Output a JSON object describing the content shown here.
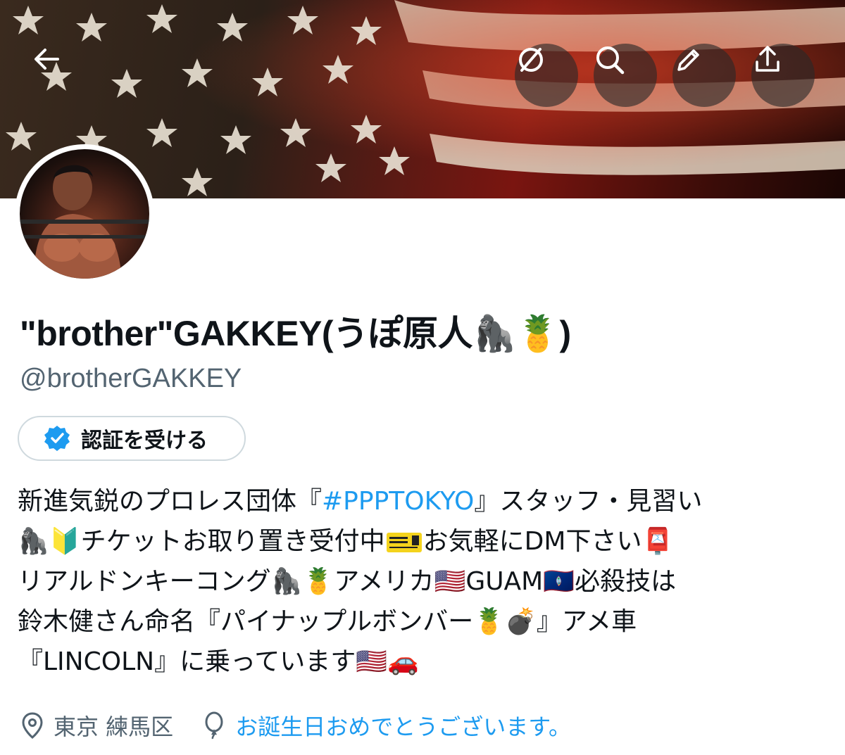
{
  "header": {
    "back_icon": "arrow-left-icon",
    "actions": [
      {
        "icon": "circle-slash-icon"
      },
      {
        "icon": "search-icon"
      },
      {
        "icon": "pencil-icon"
      },
      {
        "icon": "share-icon"
      }
    ]
  },
  "profile": {
    "display_name": "\"brother\"GAKKEY(うぽ原人🦍🍍)",
    "handle": "@brotherGAKKEY",
    "verify_button": "認証を受ける"
  },
  "bio": {
    "l1a": "新進気鋭のプロレス団体『",
    "l1link": "#PPPTOKYO",
    "l1b": "』スタッフ・見習い",
    "l2a": "🦍🔰チケットお取り置き受付中",
    "l2b": "お気軽にDM下さい📮",
    "l3": "リアルドンキーコング🦍🍍アメリカ🇺🇸GUAM🇬🇺必殺技は",
    "l4": "鈴木健さん命名『パイナップルボンバー🍍💣』アメ車",
    "l5": "『LINCOLN』に乗っています🇺🇸🚗"
  },
  "meta": {
    "location": "東京 練馬区",
    "birthday": "お誕生日おめでとうございます。"
  },
  "colors": {
    "accent": "#1d9bf0",
    "secondary_text": "#536471",
    "border": "#cfd9de"
  }
}
